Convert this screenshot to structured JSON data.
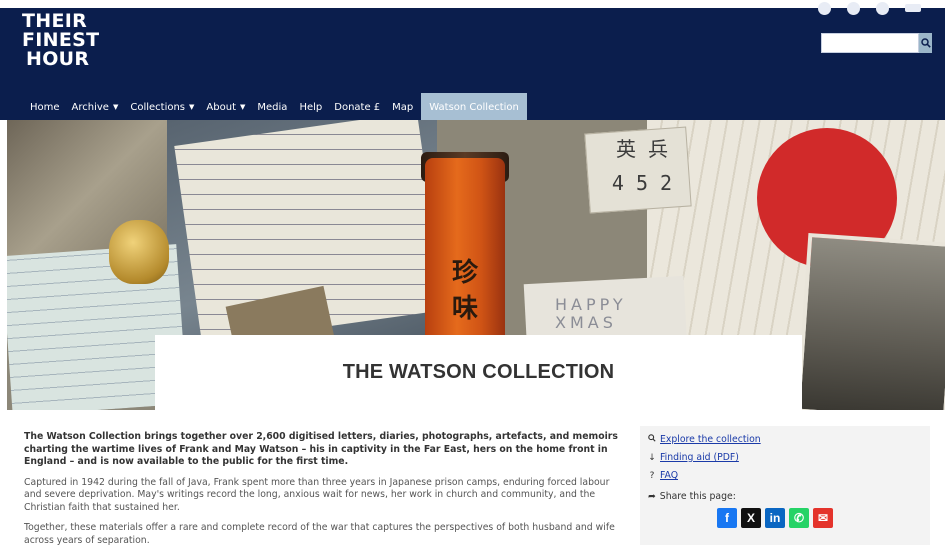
{
  "logo": {
    "line1": "THEIR",
    "line2": "FINEST",
    "line3": "HOUR"
  },
  "search": {
    "placeholder": "",
    "button_icon": "search-icon"
  },
  "social_top": [
    "facebook-icon",
    "x-icon",
    "instagram-icon",
    "menu-icon"
  ],
  "nav": {
    "home": "Home",
    "archive": "Archive",
    "collections": "Collections",
    "about": "About",
    "media": "Media",
    "help": "Help",
    "donate": "Donate £",
    "map": "Map",
    "watson": "Watson Collection"
  },
  "hero": {
    "tag_text": "英 兵\n4 5 2",
    "tin_text": "珍\n味",
    "xmas_text": "HAPPY\nXMAS"
  },
  "page_title": "THE WATSON COLLECTION",
  "content": {
    "lead": "The Watson Collection brings together over 2,600 digitised letters, diaries, photographs, artefacts, and memoirs charting the wartime lives of Frank and May Watson – his in captivity in the Far East, hers on the home front in England – and is now available to the public for the first time.",
    "p2": "Captured in 1942 during the fall of Java, Frank spent more than three years in Japanese prison camps, enduring forced labour and severe deprivation. May's writings record the long, anxious wait for news, her work in church and community, and the Christian faith that sustained her.",
    "p3": "Together, these materials offer a rare and complete record of the war that captures the perspectives of both husband and wife across years of separation."
  },
  "sidebar": {
    "explore": "Explore the collection",
    "finding_aid": "Finding aid (PDF)",
    "faq": "FAQ",
    "share_label": "Share this page:",
    "share_buttons": [
      {
        "name": "facebook",
        "glyph": "f",
        "color": "#1877f2"
      },
      {
        "name": "x",
        "glyph": "X",
        "color": "#111111"
      },
      {
        "name": "linkedin",
        "glyph": "in",
        "color": "#0a66c2"
      },
      {
        "name": "whatsapp",
        "glyph": "✆",
        "color": "#25d366"
      },
      {
        "name": "email",
        "glyph": "✉",
        "color": "#e4332b"
      }
    ]
  }
}
